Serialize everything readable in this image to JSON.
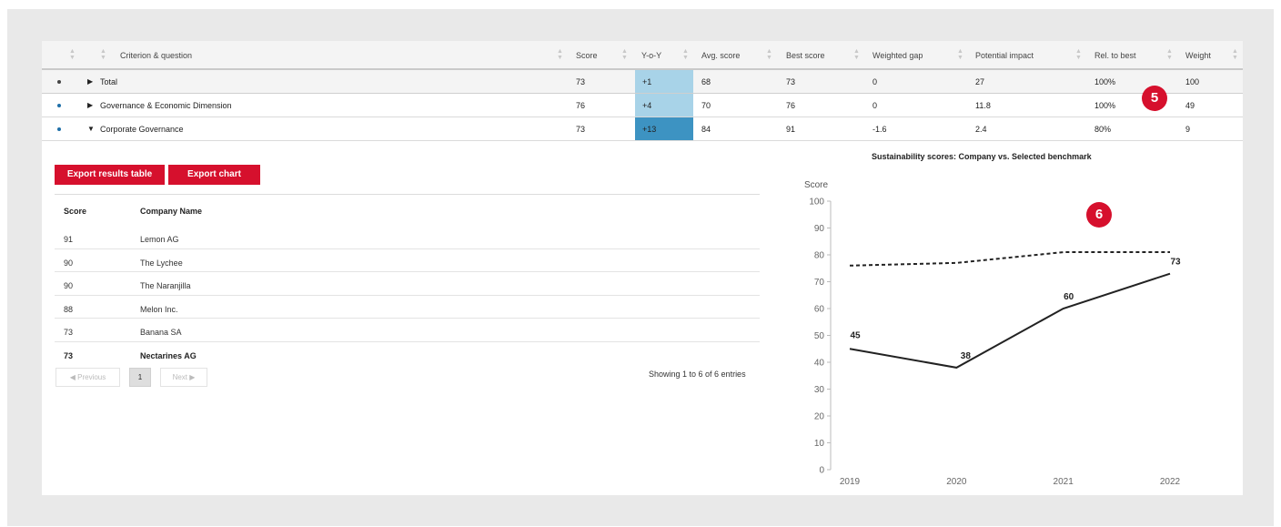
{
  "criteria_table": {
    "headers": {
      "criterion": "Criterion & question",
      "score": "Score",
      "yoy": "Y-o-Y",
      "avg_score": "Avg. score",
      "best_score": "Best score",
      "weighted_gap": "Weighted gap",
      "potential_impact": "Potential impact",
      "rel_to_best": "Rel. to best",
      "weight": "Weight"
    },
    "rows": [
      {
        "caret": "▶",
        "name": "Total",
        "score": "73",
        "yoy": "+1",
        "avg_score": "68",
        "best_score": "73",
        "weighted_gap": "0",
        "potential_impact": "27",
        "rel_to_best": "100%",
        "weight": "100",
        "bullet_color": "#444444",
        "yoy_color": "#a8d3e8"
      },
      {
        "caret": "▶",
        "name": "Governance & Economic Dimension",
        "score": "76",
        "yoy": "+4",
        "avg_score": "70",
        "best_score": "76",
        "weighted_gap": "0",
        "potential_impact": "11.8",
        "rel_to_best": "100%",
        "weight": "49",
        "bullet_color": "#1f6fa8",
        "yoy_color": "#a8d3e8"
      },
      {
        "caret": "▼",
        "name": "Corporate Governance",
        "score": "73",
        "yoy": "+13",
        "avg_score": "84",
        "best_score": "91",
        "weighted_gap": "-1.6",
        "potential_impact": "2.4",
        "rel_to_best": "80%",
        "weight": "9",
        "bullet_color": "#1f6fa8",
        "yoy_color": "#3d93c2"
      }
    ]
  },
  "badges": {
    "table": "5",
    "chart": "6"
  },
  "buttons": {
    "export_table": "Export results table",
    "export_chart": "Export chart"
  },
  "ranking_table": {
    "headers": {
      "score": "Score",
      "company": "Company Name"
    },
    "rows": [
      {
        "score": "91",
        "company": "Lemon AG"
      },
      {
        "score": "90",
        "company": "The Lychee"
      },
      {
        "score": "90",
        "company": "The Naranjilla"
      },
      {
        "score": "88",
        "company": "Melon Inc."
      },
      {
        "score": "73",
        "company": "Banana SA"
      },
      {
        "score": "73",
        "company": "Nectarines AG"
      }
    ]
  },
  "pagination": {
    "previous": "◀ Previous",
    "page": "1",
    "next": "Next ▶",
    "info": "Showing 1 to 6 of 6 entries"
  },
  "chart_data": {
    "type": "line",
    "title": "Sustainability scores: Company vs. Selected benchmark",
    "ylabel": "Score",
    "xlabel": "",
    "x": [
      "2019",
      "2020",
      "2021",
      "2022"
    ],
    "ylim": [
      0,
      100
    ],
    "yticks": [
      0,
      10,
      20,
      30,
      40,
      50,
      60,
      70,
      80,
      90,
      100
    ],
    "series": [
      {
        "values": [
          45,
          38,
          60,
          73
        ],
        "style": "solid",
        "labels": [
          "45",
          "38",
          "60",
          "73"
        ]
      },
      {
        "values": [
          76,
          77,
          81,
          81
        ],
        "style": "dashed"
      }
    ],
    "grid": false,
    "line_color": "#222222"
  }
}
